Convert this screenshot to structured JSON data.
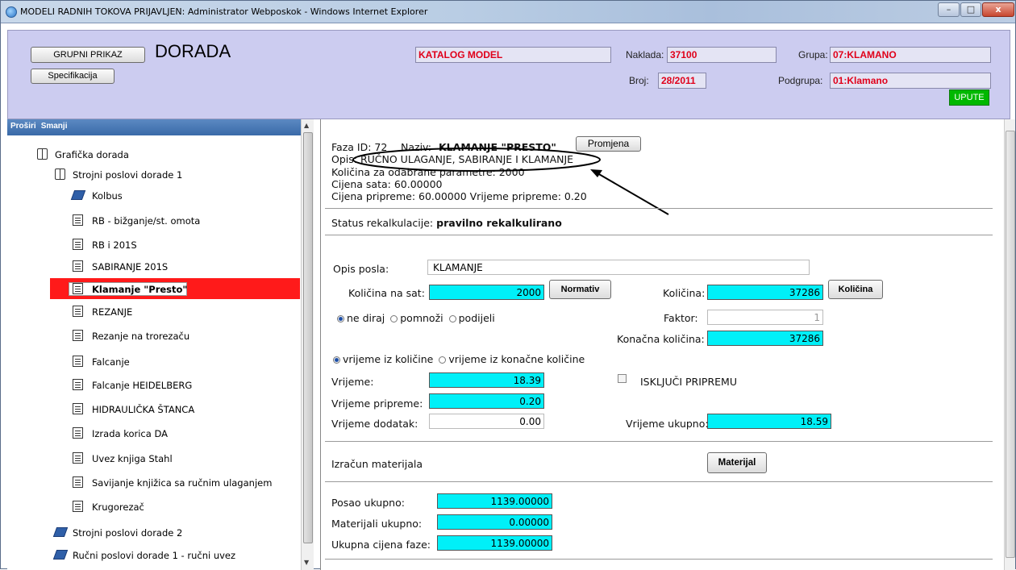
{
  "window": {
    "title": "MODELI RADNIH TOKOVA PRIJAVLJEN: Administrator Webposkok - Windows Internet Explorer",
    "min": "–",
    "max": "□",
    "close": "x"
  },
  "header": {
    "grupni_prikaz": "GRUPNI PRIKAZ",
    "dorada": "DORADA",
    "specifikacija": "Specifikacija",
    "katalog": "KATALOG MODEL",
    "naklada_label": "Naklada:",
    "naklada_value": "37100",
    "broj_label": "Broj:",
    "broj_value": "28/2011",
    "grupa_label": "Grupa:",
    "grupa_value": "07:KLAMANO",
    "podgrupa_label": "Podgrupa:",
    "podgrupa_value": "01:Klamano",
    "upute": "UPUTE"
  },
  "tree": {
    "prosiri": "Proširi",
    "smanji": "Smanji",
    "root": "Grafička dorada",
    "group1": "Strojni poslovi dorade 1",
    "items": [
      "Kolbus",
      "RB - bižganje/st. omota",
      "RB i 201S",
      "SABIRANJE 201S",
      "Klamanje \"Presto\"",
      "REZANJE",
      "Rezanje na trorezaču",
      "Falcanje",
      "Falcanje HEIDELBERG",
      "HIDRAULIČKA ŠTANCA",
      "Izrada korica DA",
      "Uvez knjiga Stahl",
      "Savijanje knjižica sa ručnim ulaganjem",
      "Krugorezač"
    ],
    "group2": "Strojni poslovi dorade 2",
    "group3": "Ručni poslovi dorade 1 - ručni uvez"
  },
  "faza": {
    "id_label": "Faza ID: 72",
    "naziv_label": "Naziv:",
    "naziv_value": "KLAMANJE \"PRESTO\"",
    "promjena": "Promjena",
    "opis_line": "Opis: RUČNO ULAGANJE, SABIRANJE I KLAMANJE",
    "kolicina_line": "Količina za odabrane parametre: 2000",
    "cijena_sata": "Cijena sata: 60.00000",
    "cijena_pripreme": "Cijena pripreme: 60.00000   Vrijeme pripreme: 0.20"
  },
  "status": {
    "label": "Status rekalkulacije:",
    "value": "pravilno rekalkulirano"
  },
  "posao": {
    "opis_label": "Opis posla:",
    "opis_value": "KLAMANJE",
    "kol_na_sat_label": "Količina na sat:",
    "kol_na_sat_value": "2000",
    "normativ": "Normativ",
    "kolicina_label": "Količina:",
    "kolicina_value": "37286",
    "kolicina_btn": "Količina",
    "radio1": [
      "ne diraj",
      "pomnoži",
      "podijeli"
    ],
    "faktor_label": "Faktor:",
    "faktor_value": "1",
    "konacna_label": "Konačna količina:",
    "konacna_value": "37286",
    "radio2": [
      "vrijeme iz količine",
      "vrijeme iz konačne količine"
    ],
    "vrijeme_label": "Vrijeme:",
    "vrijeme_value": "18.39",
    "iskljuci": "ISKLJUČI PRIPREMU",
    "vrijeme_pripreme_label": "Vrijeme pripreme:",
    "vrijeme_pripreme_value": "0.20",
    "vrijeme_dodatak_label": "Vrijeme dodatak:",
    "vrijeme_dodatak_value": "0.00",
    "vrijeme_ukupno_label": "Vrijeme ukupno:",
    "vrijeme_ukupno_value": "18.59"
  },
  "materijal": {
    "label": "Izračun materijala",
    "btn": "Materijal"
  },
  "totals": {
    "posao_label": "Posao ukupno:",
    "posao_value": "1139.00000",
    "materijali_label": "Materijali ukupno:",
    "materijali_value": "0.00000",
    "ukupna_label": "Ukupna cijena faze:",
    "ukupna_value": "1139.00000"
  },
  "colors": {
    "accent_red": "#e0001a",
    "cyan": "#00f0f8",
    "selection": "#ff1a1a",
    "header_bg": "#ccccf0",
    "upute_green": "#00b800"
  }
}
